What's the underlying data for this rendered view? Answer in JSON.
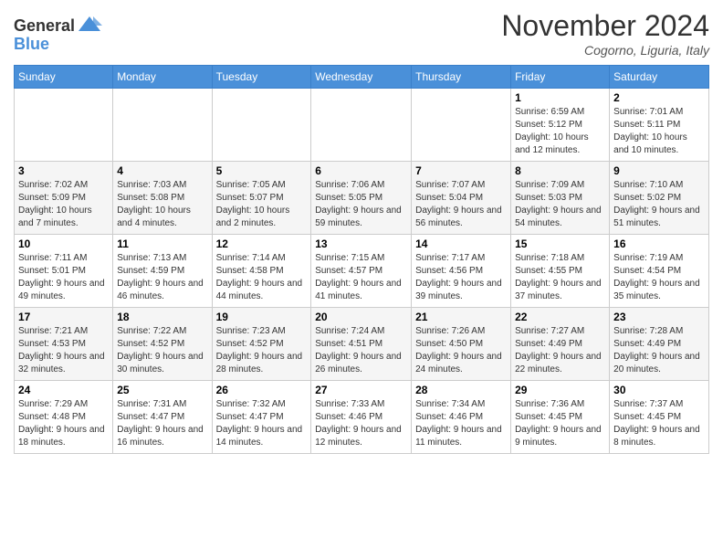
{
  "header": {
    "logo_general": "General",
    "logo_blue": "Blue",
    "month_title": "November 2024",
    "location": "Cogorno, Liguria, Italy"
  },
  "weekdays": [
    "Sunday",
    "Monday",
    "Tuesday",
    "Wednesday",
    "Thursday",
    "Friday",
    "Saturday"
  ],
  "weeks": [
    [
      {
        "day": "",
        "info": ""
      },
      {
        "day": "",
        "info": ""
      },
      {
        "day": "",
        "info": ""
      },
      {
        "day": "",
        "info": ""
      },
      {
        "day": "",
        "info": ""
      },
      {
        "day": "1",
        "info": "Sunrise: 6:59 AM\nSunset: 5:12 PM\nDaylight: 10 hours and 12 minutes."
      },
      {
        "day": "2",
        "info": "Sunrise: 7:01 AM\nSunset: 5:11 PM\nDaylight: 10 hours and 10 minutes."
      }
    ],
    [
      {
        "day": "3",
        "info": "Sunrise: 7:02 AM\nSunset: 5:09 PM\nDaylight: 10 hours and 7 minutes."
      },
      {
        "day": "4",
        "info": "Sunrise: 7:03 AM\nSunset: 5:08 PM\nDaylight: 10 hours and 4 minutes."
      },
      {
        "day": "5",
        "info": "Sunrise: 7:05 AM\nSunset: 5:07 PM\nDaylight: 10 hours and 2 minutes."
      },
      {
        "day": "6",
        "info": "Sunrise: 7:06 AM\nSunset: 5:05 PM\nDaylight: 9 hours and 59 minutes."
      },
      {
        "day": "7",
        "info": "Sunrise: 7:07 AM\nSunset: 5:04 PM\nDaylight: 9 hours and 56 minutes."
      },
      {
        "day": "8",
        "info": "Sunrise: 7:09 AM\nSunset: 5:03 PM\nDaylight: 9 hours and 54 minutes."
      },
      {
        "day": "9",
        "info": "Sunrise: 7:10 AM\nSunset: 5:02 PM\nDaylight: 9 hours and 51 minutes."
      }
    ],
    [
      {
        "day": "10",
        "info": "Sunrise: 7:11 AM\nSunset: 5:01 PM\nDaylight: 9 hours and 49 minutes."
      },
      {
        "day": "11",
        "info": "Sunrise: 7:13 AM\nSunset: 4:59 PM\nDaylight: 9 hours and 46 minutes."
      },
      {
        "day": "12",
        "info": "Sunrise: 7:14 AM\nSunset: 4:58 PM\nDaylight: 9 hours and 44 minutes."
      },
      {
        "day": "13",
        "info": "Sunrise: 7:15 AM\nSunset: 4:57 PM\nDaylight: 9 hours and 41 minutes."
      },
      {
        "day": "14",
        "info": "Sunrise: 7:17 AM\nSunset: 4:56 PM\nDaylight: 9 hours and 39 minutes."
      },
      {
        "day": "15",
        "info": "Sunrise: 7:18 AM\nSunset: 4:55 PM\nDaylight: 9 hours and 37 minutes."
      },
      {
        "day": "16",
        "info": "Sunrise: 7:19 AM\nSunset: 4:54 PM\nDaylight: 9 hours and 35 minutes."
      }
    ],
    [
      {
        "day": "17",
        "info": "Sunrise: 7:21 AM\nSunset: 4:53 PM\nDaylight: 9 hours and 32 minutes."
      },
      {
        "day": "18",
        "info": "Sunrise: 7:22 AM\nSunset: 4:52 PM\nDaylight: 9 hours and 30 minutes."
      },
      {
        "day": "19",
        "info": "Sunrise: 7:23 AM\nSunset: 4:52 PM\nDaylight: 9 hours and 28 minutes."
      },
      {
        "day": "20",
        "info": "Sunrise: 7:24 AM\nSunset: 4:51 PM\nDaylight: 9 hours and 26 minutes."
      },
      {
        "day": "21",
        "info": "Sunrise: 7:26 AM\nSunset: 4:50 PM\nDaylight: 9 hours and 24 minutes."
      },
      {
        "day": "22",
        "info": "Sunrise: 7:27 AM\nSunset: 4:49 PM\nDaylight: 9 hours and 22 minutes."
      },
      {
        "day": "23",
        "info": "Sunrise: 7:28 AM\nSunset: 4:49 PM\nDaylight: 9 hours and 20 minutes."
      }
    ],
    [
      {
        "day": "24",
        "info": "Sunrise: 7:29 AM\nSunset: 4:48 PM\nDaylight: 9 hours and 18 minutes."
      },
      {
        "day": "25",
        "info": "Sunrise: 7:31 AM\nSunset: 4:47 PM\nDaylight: 9 hours and 16 minutes."
      },
      {
        "day": "26",
        "info": "Sunrise: 7:32 AM\nSunset: 4:47 PM\nDaylight: 9 hours and 14 minutes."
      },
      {
        "day": "27",
        "info": "Sunrise: 7:33 AM\nSunset: 4:46 PM\nDaylight: 9 hours and 12 minutes."
      },
      {
        "day": "28",
        "info": "Sunrise: 7:34 AM\nSunset: 4:46 PM\nDaylight: 9 hours and 11 minutes."
      },
      {
        "day": "29",
        "info": "Sunrise: 7:36 AM\nSunset: 4:45 PM\nDaylight: 9 hours and 9 minutes."
      },
      {
        "day": "30",
        "info": "Sunrise: 7:37 AM\nSunset: 4:45 PM\nDaylight: 9 hours and 8 minutes."
      }
    ]
  ]
}
